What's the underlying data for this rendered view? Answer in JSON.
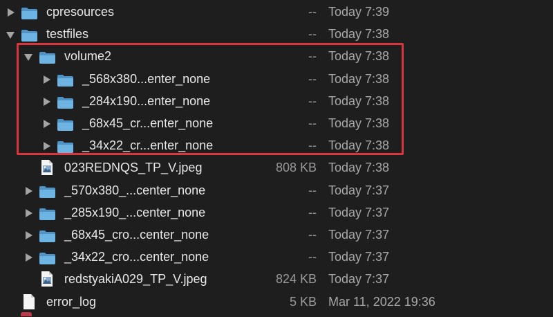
{
  "rows": [
    {
      "id": "cpresources",
      "kind": "folder",
      "expand": "right",
      "indent": 0,
      "name": "cpresources",
      "size": "--",
      "date": "Today 7:39"
    },
    {
      "id": "testfiles",
      "kind": "folder",
      "expand": "down",
      "indent": 0,
      "name": "testfiles",
      "size": "--",
      "date": "Today 7:38"
    },
    {
      "id": "volume2",
      "kind": "folder",
      "expand": "down",
      "indent": 1,
      "name": "volume2",
      "size": "--",
      "date": "Today 7:38"
    },
    {
      "id": "v2-568",
      "kind": "folder",
      "expand": "right",
      "indent": 2,
      "name": "_568x380...enter_none",
      "size": "--",
      "date": "Today 7:38"
    },
    {
      "id": "v2-284",
      "kind": "folder",
      "expand": "right",
      "indent": 2,
      "name": "_284x190...enter_none",
      "size": "--",
      "date": "Today 7:38"
    },
    {
      "id": "v2-68",
      "kind": "folder",
      "expand": "right",
      "indent": 2,
      "name": "_68x45_cr...enter_none",
      "size": "--",
      "date": "Today 7:38"
    },
    {
      "id": "v2-34",
      "kind": "folder",
      "expand": "right",
      "indent": 2,
      "name": "_34x22_cr...enter_none",
      "size": "--",
      "date": "Today 7:38"
    },
    {
      "id": "jpeg1",
      "kind": "image",
      "expand": "none",
      "indent": 1,
      "name": "023REDNQS_TP_V.jpeg",
      "size": "808 KB",
      "date": "Today 7:38"
    },
    {
      "id": "tf-570",
      "kind": "folder",
      "expand": "right",
      "indent": 1,
      "name": "_570x380_...center_none",
      "size": "--",
      "date": "Today 7:37"
    },
    {
      "id": "tf-285",
      "kind": "folder",
      "expand": "right",
      "indent": 1,
      "name": "_285x190_...center_none",
      "size": "--",
      "date": "Today 7:37"
    },
    {
      "id": "tf-68",
      "kind": "folder",
      "expand": "right",
      "indent": 1,
      "name": "_68x45_cro...center_none",
      "size": "--",
      "date": "Today 7:37"
    },
    {
      "id": "tf-34",
      "kind": "folder",
      "expand": "right",
      "indent": 1,
      "name": "_34x22_cro...center_none",
      "size": "--",
      "date": "Today 7:37"
    },
    {
      "id": "jpeg2",
      "kind": "image",
      "expand": "none",
      "indent": 1,
      "name": "redstyakiA029_TP_V.jpeg",
      "size": "824 KB",
      "date": "Today 7:37"
    },
    {
      "id": "errorlog",
      "kind": "document",
      "expand": "none",
      "indent": 0,
      "name": "error_log",
      "size": "5 KB",
      "date": "Mar 11, 2022 19:36"
    }
  ],
  "icons": {
    "folder": "folder-icon",
    "image": "image-file-icon",
    "document": "document-icon",
    "expand_right": "disclosure-triangle-collapsed-icon",
    "expand_down": "disclosure-triangle-expanded-icon"
  },
  "colors": {
    "background": "#1e1e1e",
    "folder": "#5fa8d8",
    "highlight": "#d9363e"
  }
}
